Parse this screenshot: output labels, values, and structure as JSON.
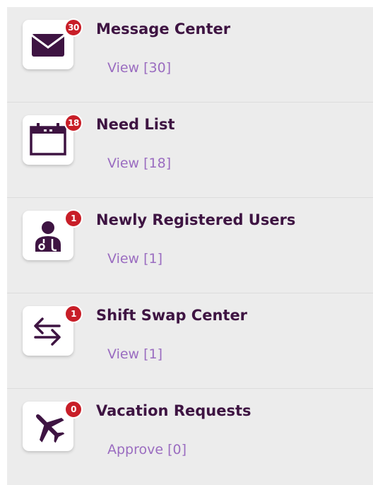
{
  "colors": {
    "panel_bg": "#ececec",
    "title": "#3e1442",
    "icon": "#3e1442",
    "link": "#9a6cc0",
    "badge": "#c81e28"
  },
  "items": [
    {
      "title": "Message Center",
      "badge": "30",
      "action": "View [30]",
      "icon": "envelope-icon"
    },
    {
      "title": "Need List",
      "badge": "18",
      "action": "View [18]",
      "icon": "calendar-icon"
    },
    {
      "title": "Newly Registered Users",
      "badge": "1",
      "action": "View [1]",
      "icon": "doctor-icon"
    },
    {
      "title": "Shift Swap Center",
      "badge": "1",
      "action": "View [1]",
      "icon": "swap-arrows-icon"
    },
    {
      "title": "Vacation Requests",
      "badge": "0",
      "action": "Approve [0]",
      "icon": "airplane-icon"
    }
  ]
}
